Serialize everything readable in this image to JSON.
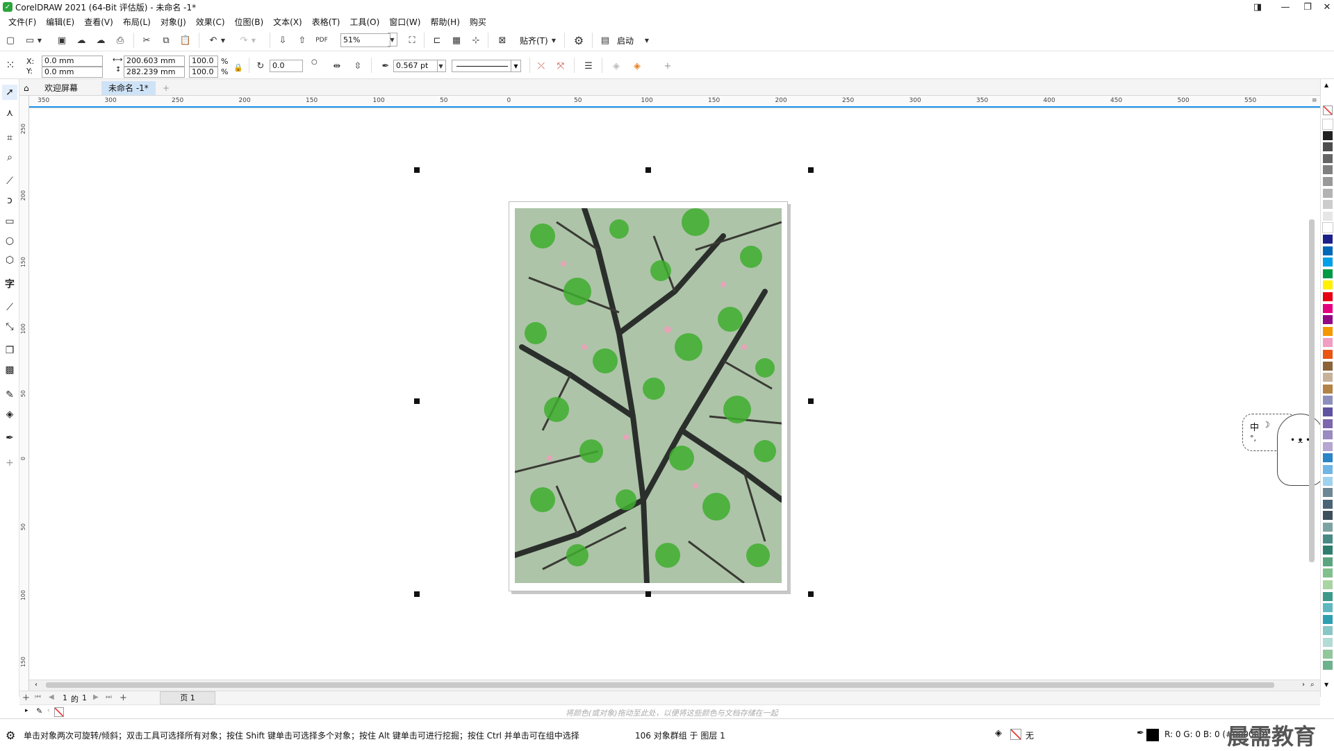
{
  "window": {
    "title": "CorelDRAW 2021 (64-Bit 评估版) - 未命名 -1*"
  },
  "menu": [
    "文件(F)",
    "编辑(E)",
    "查看(V)",
    "布局(L)",
    "对象(J)",
    "效果(C)",
    "位图(B)",
    "文本(X)",
    "表格(T)",
    "工具(O)",
    "窗口(W)",
    "帮助(H)",
    "购买"
  ],
  "toolbar": {
    "zoom": "51%",
    "snap_label": "贴齐(T)",
    "launch_label": "启动"
  },
  "properties": {
    "x_label": "X:",
    "y_label": "Y:",
    "x_value": "0.0 mm",
    "y_value": "0.0 mm",
    "width": "200.603 mm",
    "height": "282.239 mm",
    "scale_w": "100.0",
    "scale_h": "100.0",
    "pct": "%",
    "rotation": "0.0",
    "outline_width": "0.567 pt"
  },
  "tabs": [
    {
      "label": "欢迎屏幕",
      "active": false
    },
    {
      "label": "未命名 -1*",
      "active": true
    }
  ],
  "ruler_h": [
    "350",
    "300",
    "250",
    "200",
    "150",
    "100",
    "50",
    "0",
    "50",
    "100",
    "150",
    "200",
    "250",
    "300",
    "350",
    "400",
    "450",
    "500",
    "550"
  ],
  "ruler_v": [
    "250",
    "200",
    "150",
    "100",
    "50",
    "0",
    "50",
    "100",
    "150"
  ],
  "page_nav": {
    "current": "1",
    "of": "的",
    "total": "1",
    "page_tab": "页 1"
  },
  "doc_palette_hint": "将颜色(或对象)拖动至此处，以便将这些颜色与文档存储在一起",
  "status": {
    "hint": "单击对象两次可旋转/倾斜；双击工具可选择所有对象；按住 Shift 键单击可选择多个对象；按住 Alt 键单击可进行挖掘；按住 Ctrl 并单击可在组中选择",
    "selection": "106 对象群组 于 图层 1",
    "fill_label": "无",
    "color_readout": "R: 0 G: 0 B: 0 (#000000)"
  },
  "mascot": {
    "label": "中"
  },
  "watermark": "晨需教育",
  "colors": {
    "accent": "#2aa53b",
    "selection": "#111111",
    "ruler_marker": "#2196f3"
  },
  "palette_colors": [
    "#ffffff",
    "#222222",
    "#4d4d4d",
    "#666666",
    "#808080",
    "#999999",
    "#b3b3b3",
    "#cccccc",
    "#e6e6e6",
    "#ffffff",
    "#1d2088",
    "#0068b7",
    "#00a0e9",
    "#009944",
    "#fff100",
    "#e60012",
    "#e4007f",
    "#920783",
    "#f39800",
    "#f19ec2",
    "#ea5514",
    "#8c6239",
    "#c7b299",
    "#b28247",
    "#8c8fbd",
    "#5f52a0",
    "#7d66ad",
    "#9a8bc3",
    "#b5a6d2",
    "#2a84c6",
    "#6fb6e5",
    "#9fd2ef",
    "#6d8795",
    "#4b6475",
    "#3e4f5c",
    "#7ca3a3",
    "#4a8a84",
    "#2f7d6d",
    "#5aa57d",
    "#7fc08d",
    "#a9d5a3",
    "#3d9a8a",
    "#5fb7c0",
    "#2d9fb1",
    "#87c7c6",
    "#b2dcd5",
    "#91c79a",
    "#6cb28c"
  ]
}
